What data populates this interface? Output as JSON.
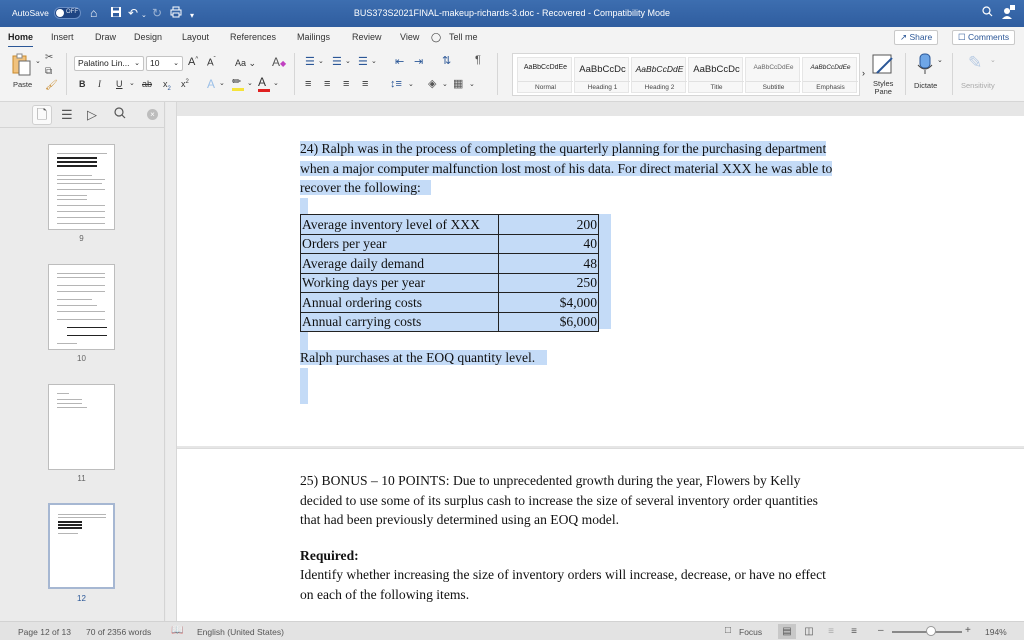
{
  "titlebar": {
    "autosave_label": "AutoSave",
    "autosave_state": "OFF",
    "document_title": "BUS373S2021FINAL-makeup-richards-3.doc  -  Recovered  -  Compatibility Mode",
    "quick_access": [
      "home-icon",
      "save-icon",
      "undo-icon",
      "redo-icon",
      "print-icon",
      "customize-icon"
    ]
  },
  "tabs": {
    "items": [
      "Home",
      "Insert",
      "Draw",
      "Design",
      "Layout",
      "References",
      "Mailings",
      "Review",
      "View"
    ],
    "active": "Home",
    "tell_me": "Tell me",
    "share": "Share",
    "comments": "Comments"
  },
  "ribbon": {
    "paste_label": "Paste",
    "font_name": "Palatino Lin...",
    "font_size": "10",
    "case_label": "Aa",
    "bold": "B",
    "italic": "I",
    "underline": "U",
    "strikethrough": "ab",
    "subscript": "x",
    "superscript": "x",
    "highlight_color": "#f5e33a",
    "font_color": "#e02020",
    "styles": [
      {
        "preview": "AaBbCcDdEe",
        "name": "Normal"
      },
      {
        "preview": "AaBbCcDc",
        "name": "Heading 1"
      },
      {
        "preview": "AaBbCcDdE",
        "name": "Heading 2"
      },
      {
        "preview": "AaBbCcDc",
        "name": "Title"
      },
      {
        "preview": "AaBbCcDdEe",
        "name": "Subtitle"
      },
      {
        "preview": "AaBbCcDdEe",
        "name": "Emphasis"
      }
    ],
    "styles_pane_line1": "Styles",
    "styles_pane_line2": "Pane",
    "dictate": "Dictate",
    "sensitivity": "Sensitivity"
  },
  "nav_pane": {
    "pages": [
      "9",
      "10",
      "11",
      "12"
    ],
    "active_page": "12"
  },
  "document": {
    "q24_lines": [
      "24) Ralph was in the process of completing the quarterly planning for the purchasing department",
      "when a major computer malfunction lost most of his data. For direct material XXX he was able to",
      "recover the following:"
    ],
    "table": [
      {
        "label": "Average inventory level of XXX",
        "value": "200"
      },
      {
        "label": "Orders per year",
        "value": "40"
      },
      {
        "label": "Average daily demand",
        "value": "48"
      },
      {
        "label": "Working days per year",
        "value": "250"
      },
      {
        "label": "Annual ordering costs",
        "value": "$4,000"
      },
      {
        "label": "Annual carrying costs",
        "value": "$6,000"
      }
    ],
    "eoq_line": "Ralph purchases at the EOQ quantity level.",
    "q25_lines": [
      "25) BONUS – 10 POINTS: Due to unprecedented growth during the year, Flowers by Kelly",
      "decided to use some of its surplus cash to increase the size of several inventory order quantities",
      "that had been previously determined using an EOQ model."
    ],
    "required_label": "Required:",
    "required_lines": [
      "Identify whether increasing the size of inventory orders will increase, decrease, or have no effect",
      "on each of the following items."
    ]
  },
  "status": {
    "page": "Page 12 of 13",
    "words": "70 of 2356 words",
    "language": "English (United States)",
    "focus": "Focus",
    "zoom": "194%",
    "zoom_minus": "–",
    "zoom_plus": "+"
  },
  "colors": {
    "titlebar": "#2f5d9f",
    "selection": "#c4dbf7",
    "accent": "#2b5797"
  }
}
